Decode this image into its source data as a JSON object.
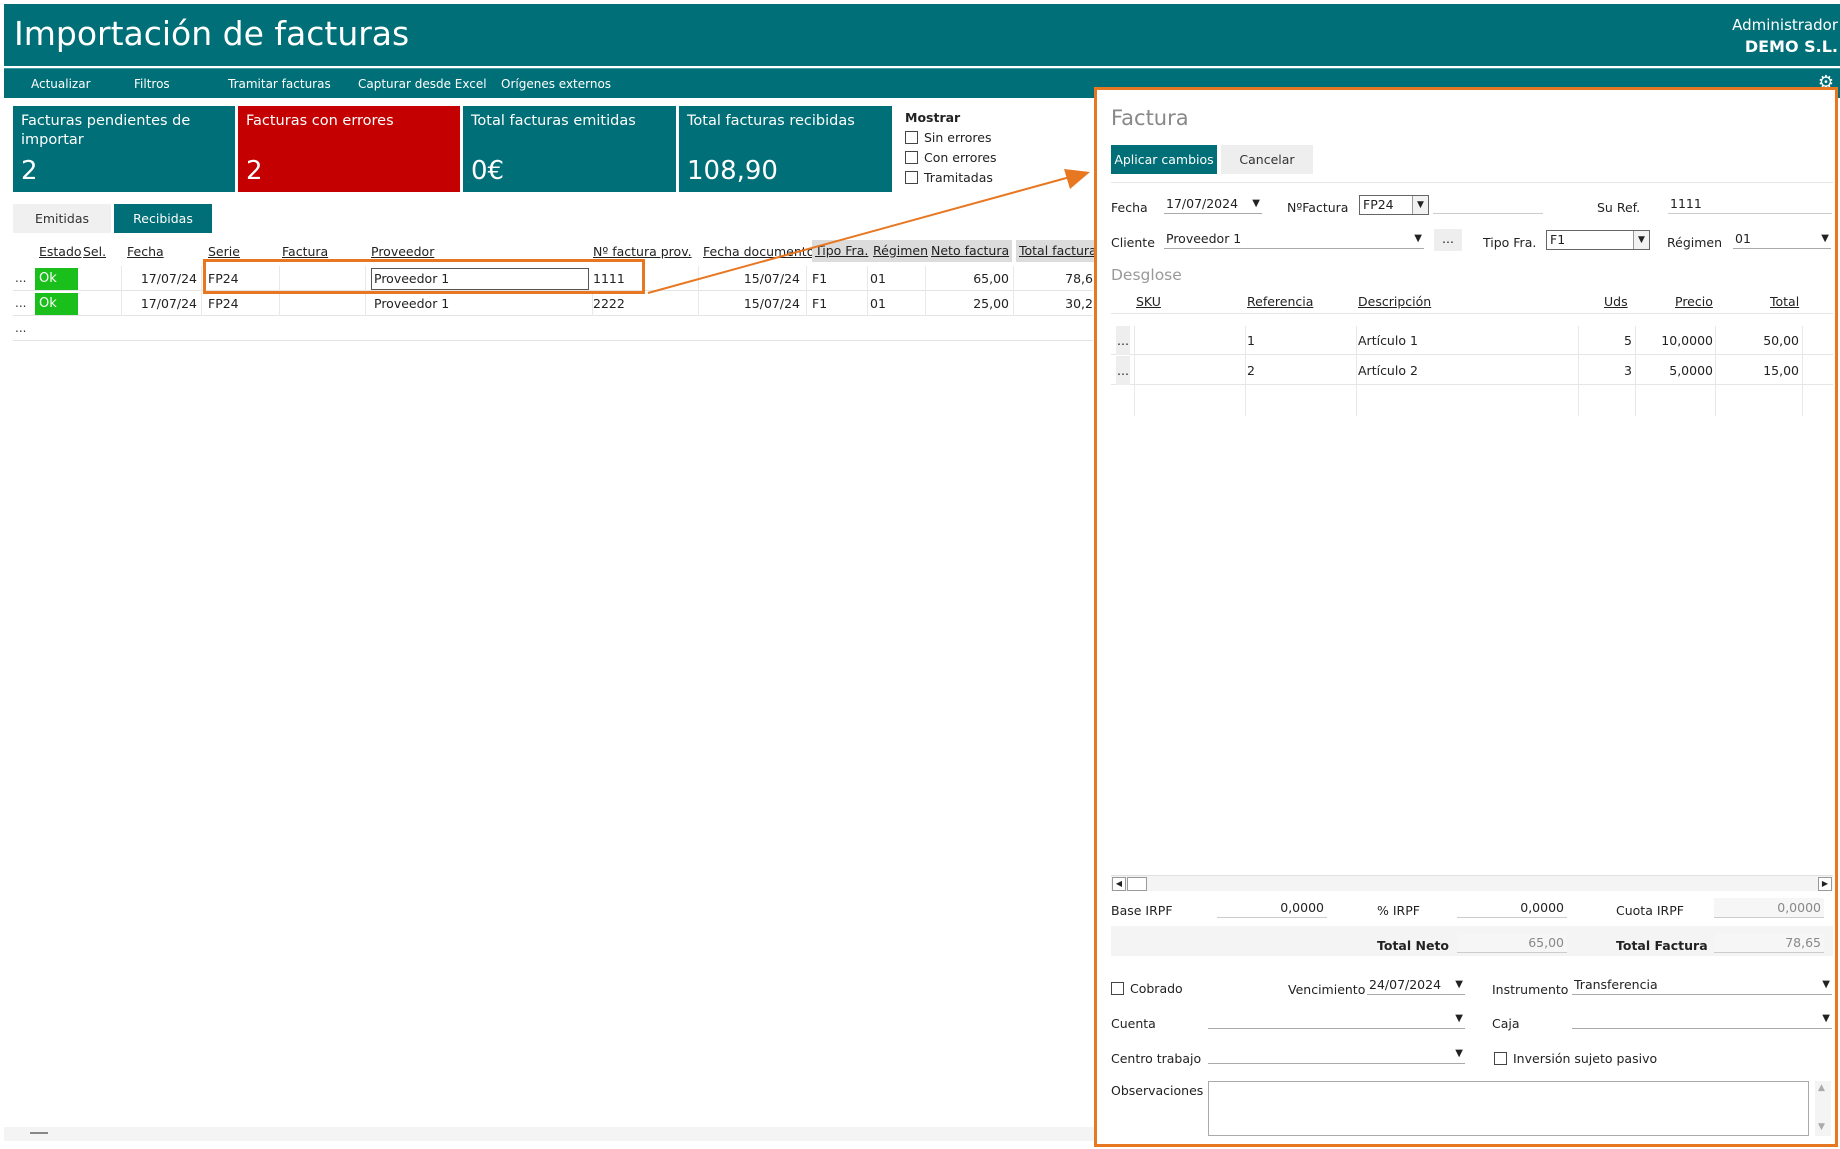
{
  "header": {
    "title": "Importación de facturas",
    "user": "Administrador",
    "company": "DEMO S.L."
  },
  "toolbar": {
    "items": [
      "Actualizar",
      "Filtros",
      "Tramitar facturas",
      "Capturar desde Excel",
      "Orígenes externos"
    ]
  },
  "tiles": [
    {
      "label": "Facturas pendientes de importar",
      "value": "2"
    },
    {
      "label": "Facturas con errores",
      "value": "2"
    },
    {
      "label": "Total facturas emitidas",
      "value": "0€"
    },
    {
      "label": "Total facturas recibidas",
      "value": "108,90"
    }
  ],
  "show": {
    "title": "Mostrar",
    "options": [
      "Sin errores",
      "Con errores",
      "Tramitadas"
    ]
  },
  "tabs": {
    "emitidas": "Emitidas",
    "recibidas": "Recibidas"
  },
  "grid": {
    "columns": [
      "Estado",
      "Sel.",
      "Fecha",
      "Serie",
      "Factura",
      "Proveedor",
      "Nº factura prov.",
      "Fecha documento",
      "Tipo Fra.",
      "Régimen",
      "Neto factura",
      "Total factura"
    ],
    "rows": [
      {
        "dots": "...",
        "estado": "Ok",
        "fecha": "17/07/24",
        "serie": "FP24",
        "factura": "",
        "proveedor": "Proveedor 1",
        "nfactura": "1111",
        "fechadoc": "15/07/24",
        "tipo": "F1",
        "regimen": "01",
        "neto": "65,00",
        "total": "78,6"
      },
      {
        "dots": "...",
        "estado": "Ok",
        "fecha": "17/07/24",
        "serie": "FP24",
        "factura": "",
        "proveedor": "Proveedor 1",
        "nfactura": "2222",
        "fechadoc": "15/07/24",
        "tipo": "F1",
        "regimen": "01",
        "neto": "25,00",
        "total": "30,2"
      }
    ],
    "new_row_dots": "..."
  },
  "detail": {
    "title": "Factura",
    "apply": "Aplicar cambios",
    "cancel": "Cancelar",
    "fecha_label": "Fecha",
    "fecha": "17/07/2024",
    "nfactura_label": "NºFactura",
    "nfactura": "FP24",
    "suref_label": "Su Ref.",
    "suref": "1111",
    "cliente_label": "Cliente",
    "cliente": "Proveedor 1",
    "cliente_btn": "...",
    "tipo_label": "Tipo Fra.",
    "tipo": "F1",
    "regimen_label": "Régimen",
    "regimen": "01",
    "section": "Desglose",
    "lines_columns": [
      "SKU",
      "Referencia",
      "Descripción",
      "Uds",
      "Precio",
      "Total"
    ],
    "lines": [
      {
        "dots": "...",
        "sku": "",
        "ref": "1",
        "desc": "Artículo 1",
        "uds": "5",
        "precio": "10,0000",
        "total": "50,00"
      },
      {
        "dots": "...",
        "sku": "",
        "ref": "2",
        "desc": "Artículo 2",
        "uds": "3",
        "precio": "5,0000",
        "total": "15,00"
      }
    ],
    "base_irpf_label": "Base IRPF",
    "base_irpf": "0,0000",
    "pct_irpf_label": "% IRPF",
    "pct_irpf": "0,0000",
    "cuota_irpf_label": "Cuota IRPF",
    "cuota_irpf": "0,0000",
    "total_neto_label": "Total Neto",
    "total_neto": "65,00",
    "total_factura_label": "Total Factura",
    "total_factura": "78,65",
    "cobrado_label": "Cobrado",
    "vencimiento_label": "Vencimiento",
    "vencimiento": "24/07/2024",
    "instrumento_label": "Instrumento",
    "instrumento": "Transferencia",
    "cuenta_label": "Cuenta",
    "cuenta": "",
    "caja_label": "Caja",
    "caja": "",
    "centro_label": "Centro trabajo",
    "centro": "",
    "inversion_label": "Inversión sujeto pasivo",
    "observaciones_label": "Observaciones"
  },
  "colors": {
    "teal": "#006f77",
    "error_red": "#c40000",
    "ok_green": "#1bbf1b",
    "highlight_orange": "#e87722"
  }
}
